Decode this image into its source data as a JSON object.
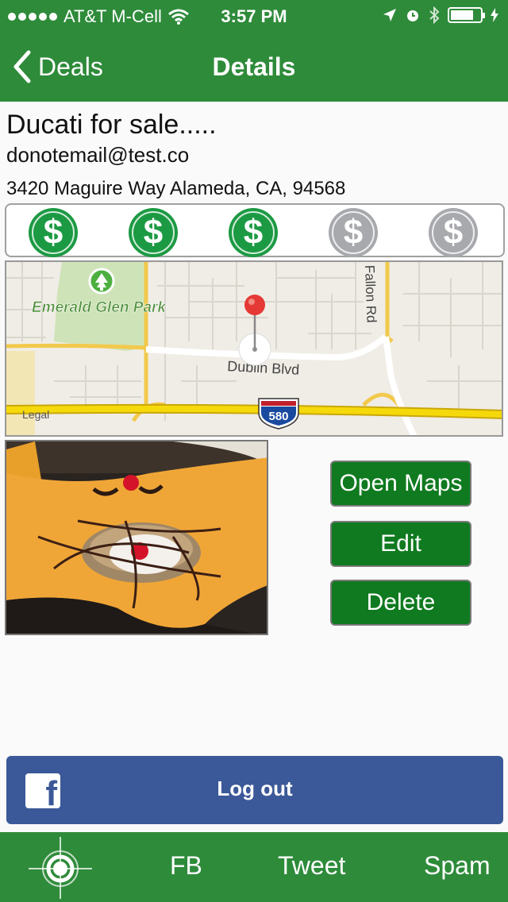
{
  "status_bar": {
    "carrier": "AT&T M-Cell",
    "time": "3:57 PM"
  },
  "nav": {
    "back_label": "Deals",
    "title": "Details"
  },
  "deal": {
    "title": "Ducati for sale.....",
    "email": "donotemail@test.co",
    "address": "3420 Maguire Way Alameda, CA, 94568",
    "rating": 3,
    "rating_max": 5,
    "rating_symbol": "$"
  },
  "map": {
    "park_label": "Emerald Glen Park",
    "street_label": "Dublin Blvd",
    "road_label": "Fallon Rd",
    "highway_label": "580",
    "legal_label": "Legal"
  },
  "buttons": {
    "open_maps": "Open Maps",
    "edit": "Edit",
    "delete": "Delete"
  },
  "facebook": {
    "logout_label": "Log out"
  },
  "tabbar": {
    "fb": "FB",
    "tweet": "Tweet",
    "spam": "Spam"
  },
  "colors": {
    "brand_green": "#2e8b3a",
    "button_green": "#0f7a1f",
    "coin_on": "#1c9a43",
    "coin_off": "#a7a9ad",
    "facebook_blue": "#3b5998"
  }
}
